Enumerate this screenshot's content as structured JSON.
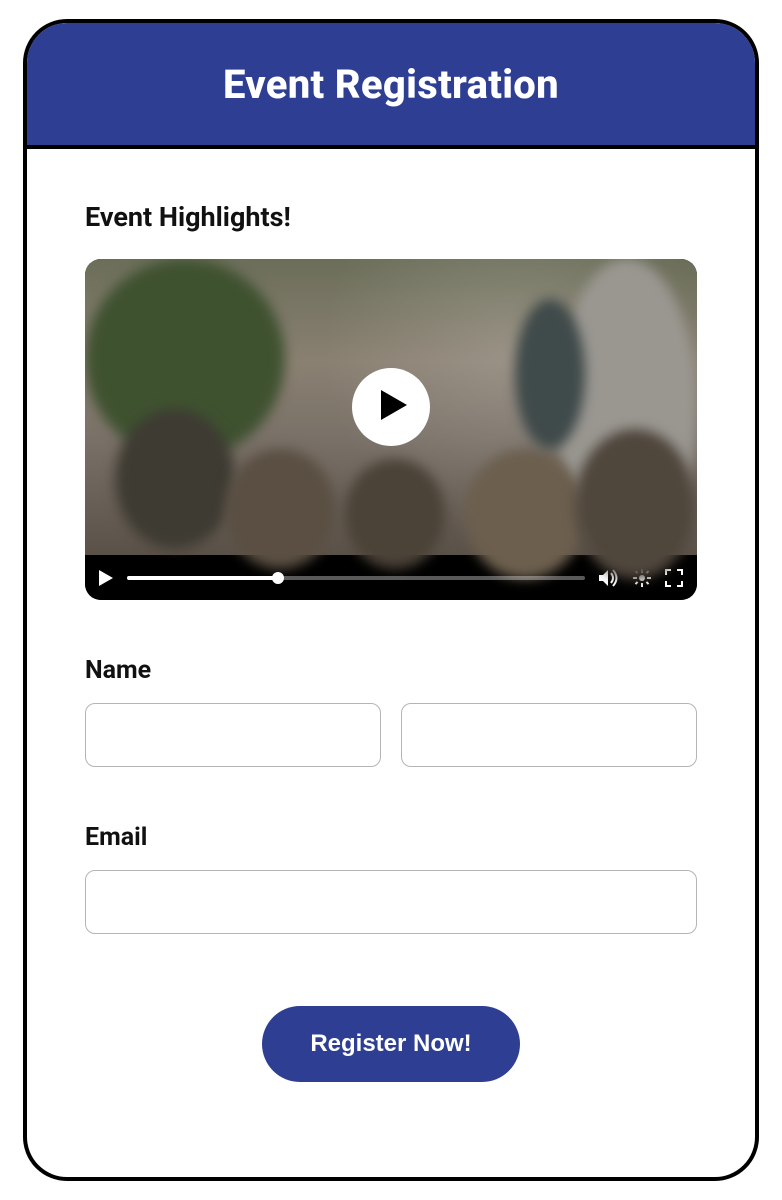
{
  "header": {
    "title": "Event Registration"
  },
  "video": {
    "section_title": "Event Highlights!",
    "progress_percent": 33
  },
  "form": {
    "name_label": "Name",
    "first_name_value": "",
    "last_name_value": "",
    "email_label": "Email",
    "email_value": "",
    "submit_label": "Register Now!"
  },
  "colors": {
    "accent": "#2e3e93"
  }
}
